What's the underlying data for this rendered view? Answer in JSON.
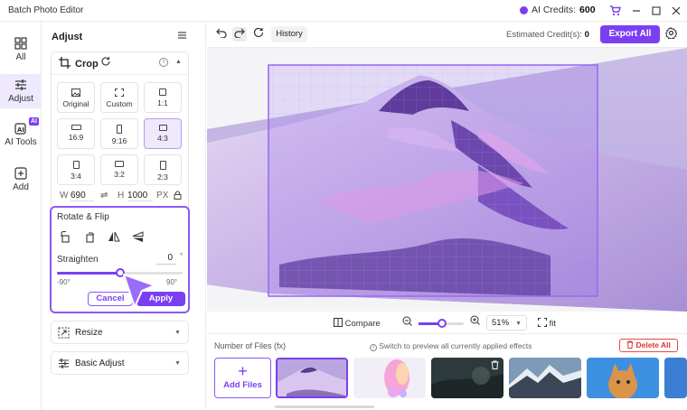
{
  "app": {
    "title": "Batch Photo Editor"
  },
  "titlebar": {
    "credits_label": "AI Credits:",
    "credits_value": "600",
    "icons": [
      "coin-icon",
      "cart-icon",
      "minimize-icon",
      "maximize-icon",
      "close-icon"
    ]
  },
  "rail": {
    "items": [
      {
        "label": "All",
        "icon": "grid-icon"
      },
      {
        "label": "Adjust",
        "icon": "sliders-icon",
        "active": true
      },
      {
        "label": "AI Tools",
        "icon": "ai-tools-icon",
        "badge": "AI"
      },
      {
        "label": "Add",
        "icon": "add-box-icon"
      }
    ]
  },
  "panel": {
    "title": "Adjust",
    "crop": {
      "label": "Crop",
      "ratios": [
        {
          "label": "Original"
        },
        {
          "label": "Custom"
        },
        {
          "label": "1:1"
        },
        {
          "label": "16:9"
        },
        {
          "label": "9:16"
        },
        {
          "label": "4:3",
          "active": true
        },
        {
          "label": "3:4"
        },
        {
          "label": "3:2"
        },
        {
          "label": "2:3"
        }
      ],
      "width_label": "W",
      "width_value": "690",
      "height_label": "H",
      "height_value": "1000",
      "unit": "PX"
    },
    "rotate": {
      "label": "Rotate & Flip",
      "straighten_label": "Straighten",
      "straighten_value": "0",
      "degree_symbol": "°",
      "min_label": "-90°",
      "max_label": "90°",
      "slider_fraction": 0.5,
      "cancel_label": "Cancel",
      "apply_label": "Apply"
    },
    "resize_label": "Resize",
    "basic_adjust_label": "Basic Adjust"
  },
  "toolbar": {
    "history_label": "History",
    "estimated_label": "Estimated Credit(s):",
    "estimated_value": "0",
    "export_label": "Export All"
  },
  "zoom": {
    "compare_label": "Compare",
    "value": "51%",
    "slider_fraction": 0.51,
    "fit_label": "fit"
  },
  "files": {
    "count_label": "Number of Files (fx)",
    "hint": "Switch to preview all currently applied effects",
    "delete_all_label": "Delete All",
    "add_files_label": "Add Files"
  },
  "colors": {
    "accent": "#7b3ff2",
    "danger": "#d33"
  }
}
